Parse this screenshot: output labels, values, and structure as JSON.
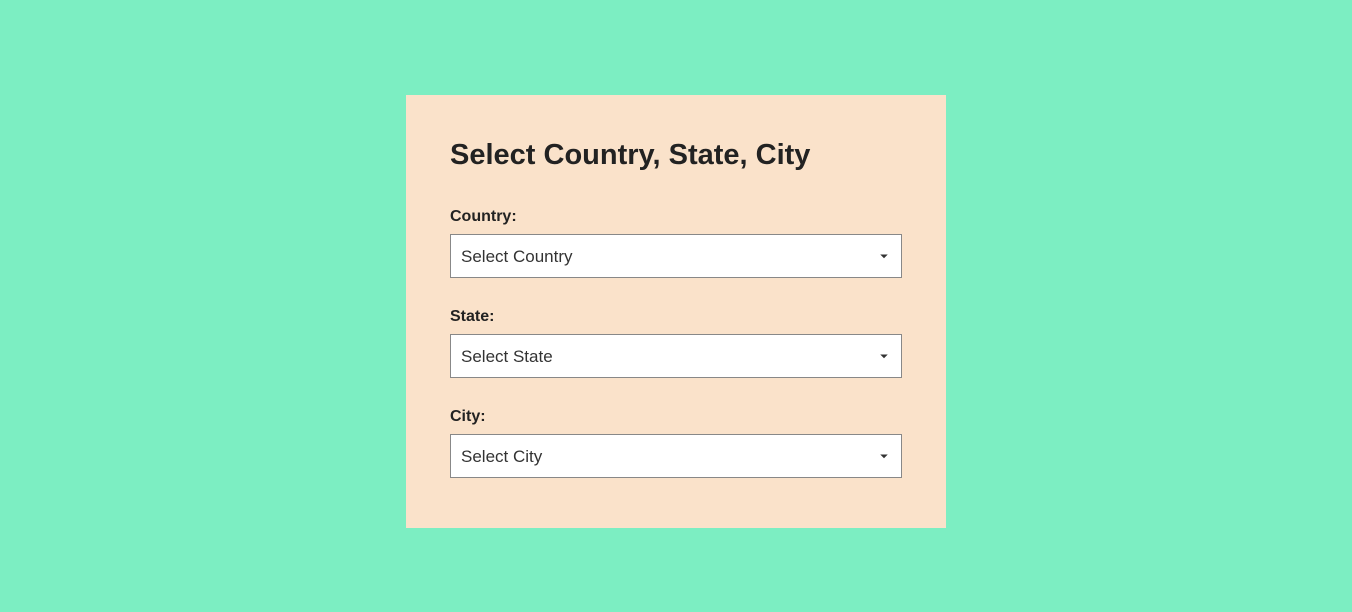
{
  "form": {
    "title": "Select Country, State, City",
    "fields": {
      "country": {
        "label": "Country:",
        "selected": "Select Country"
      },
      "state": {
        "label": "State:",
        "selected": "Select State"
      },
      "city": {
        "label": "City:",
        "selected": "Select City"
      }
    }
  }
}
